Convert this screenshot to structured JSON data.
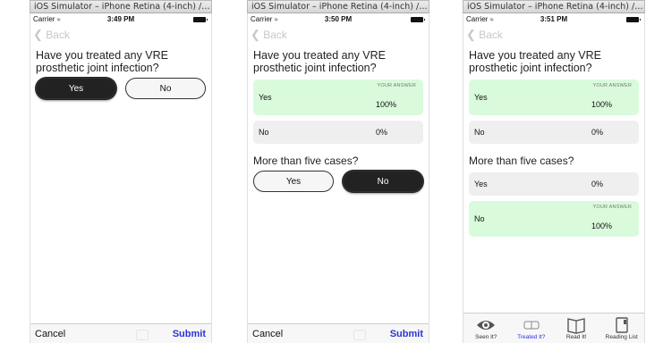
{
  "window_title": "iOS Simulator – iPhone Retina (4-inch) / iOS 7...",
  "carrier": "Carrier",
  "nav": {
    "back_label": "Back"
  },
  "screens": [
    {
      "time": "3:49 PM",
      "question1": "Have you treated any VRE prosthetic joint infection?",
      "yes_label": "Yes",
      "no_label": "No",
      "cancel_label": "Cancel",
      "submit_label": "Submit"
    },
    {
      "time": "3:50 PM",
      "question1": "Have you treated any VRE prosthetic joint infection?",
      "answers": [
        {
          "label": "Yes",
          "pct": "100%",
          "badge": "YOUR ANSWER"
        },
        {
          "label": "No",
          "pct": "0%"
        }
      ],
      "question2": "More than five cases?",
      "yes_label": "Yes",
      "no_label": "No",
      "cancel_label": "Cancel",
      "submit_label": "Submit"
    },
    {
      "time": "3:51 PM",
      "question1": "Have you treated any VRE prosthetic joint infection?",
      "answers1": [
        {
          "label": "Yes",
          "pct": "100%",
          "badge": "YOUR ANSWER"
        },
        {
          "label": "No",
          "pct": "0%"
        }
      ],
      "question2": "More than five cases?",
      "answers2": [
        {
          "label": "Yes",
          "pct": "0%"
        },
        {
          "label": "No",
          "pct": "100%",
          "badge": "YOUR ANSWER"
        }
      ],
      "tabs": [
        {
          "label": "Seen It?",
          "icon": "eye-icon"
        },
        {
          "label": "Treated It?",
          "icon": "pill-icon"
        },
        {
          "label": "Read It!",
          "icon": "book-icon"
        },
        {
          "label": "Reading List",
          "icon": "list-icon"
        }
      ]
    }
  ],
  "colors": {
    "accent": "#2a34d6",
    "answer_highlight": "#d9fbdc",
    "selected_pill": "#222222"
  }
}
